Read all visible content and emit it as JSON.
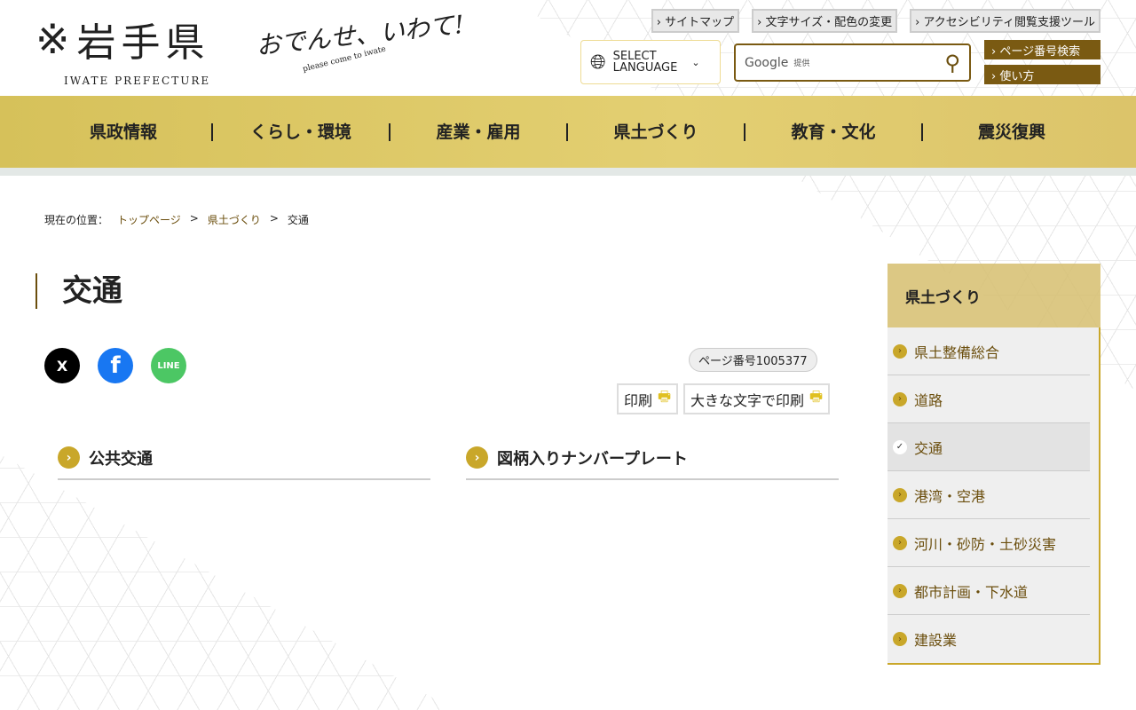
{
  "header": {
    "logo_kanji": "岩手県",
    "logo_sub": "IWATE PREFECTURE",
    "catch": "おでんせ、いわて!",
    "catch_sub": "please come to iwate",
    "top_links": [
      "サイトマップ",
      "文字サイズ・配色の変更",
      "アクセシビリティ閲覧支援ツール"
    ],
    "lang_line1": "SELECT",
    "lang_line2": "LANGUAGE",
    "search_google": "Google",
    "search_provided": "提供",
    "page_no_search": "ページ番号検索",
    "howto": "使い方"
  },
  "nav": [
    "県政情報",
    "くらし・環境",
    "産業・雇用",
    "県土づくり",
    "教育・文化",
    "震災復興"
  ],
  "breadcrumb": {
    "label": "現在の位置：",
    "items": [
      "トップページ",
      "県土づくり"
    ],
    "current": "交通"
  },
  "page": {
    "title": "交通",
    "page_number": "ページ番号1005377",
    "print": "印刷",
    "print_large": "大きな文字で印刷",
    "sns": [
      "X",
      "f",
      "LINE"
    ]
  },
  "categories": [
    "公共交通",
    "図柄入りナンバープレート"
  ],
  "sidebar": {
    "title": "県土づくり",
    "items": [
      "県土整備総合",
      "道路",
      "交通",
      "港湾・空港",
      "河川・砂防・土砂災害",
      "都市計画・下水道",
      "建設業"
    ],
    "current_index": 2
  }
}
